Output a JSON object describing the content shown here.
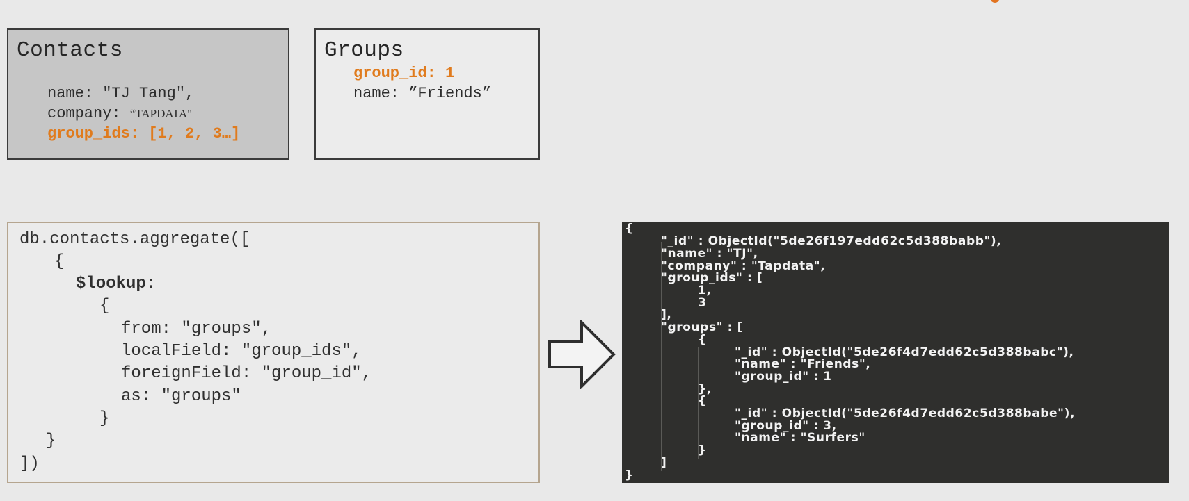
{
  "contacts": {
    "title": "Contacts",
    "name_key": "name: ",
    "name_val": "\"TJ Tang\",",
    "company_key": "company: ",
    "company_val": "“TAPDATA\"",
    "group_ids": "group_ids: [1, 2, 3…]"
  },
  "groups": {
    "title": "Groups",
    "group_id": "group_id: 1",
    "name_key": "name: ",
    "name_val": "”Friends”"
  },
  "query": {
    "lines": [
      "db.contacts.aggregate([",
      "{",
      "$lookup:",
      "{",
      "from: \"groups\",",
      "localField: \"group_ids\",",
      "foreignField: \"group_id\",",
      "as: \"groups\"",
      "}",
      "}",
      "])"
    ]
  },
  "result": {
    "lines": [
      "{",
      "\"_id\" : ObjectId(\"5de26f197edd62c5d388babb\"),",
      "\"name\" : \"TJ\",",
      "\"company\" : \"Tapdata\",",
      "\"group_ids\" : [",
      "1,",
      "3",
      "],",
      "\"groups\" : [",
      "{",
      "\"_id\" : ObjectId(\"5de26f4d7edd62c5d388babc\"),",
      "\"name\" : \"Friends\",",
      "\"group_id\" : 1",
      "},",
      "{",
      "\"_id\" : ObjectId(\"5de26f4d7edd62c5d388babe\"),",
      "\"group_id\" : 3,",
      "\"name\" : \"Surfers\"",
      "}",
      "]",
      "}"
    ]
  },
  "colors": {
    "accent": "#e07b1d",
    "result_bg": "#2f2f2d",
    "contacts_bg": "#c6c6c6"
  }
}
